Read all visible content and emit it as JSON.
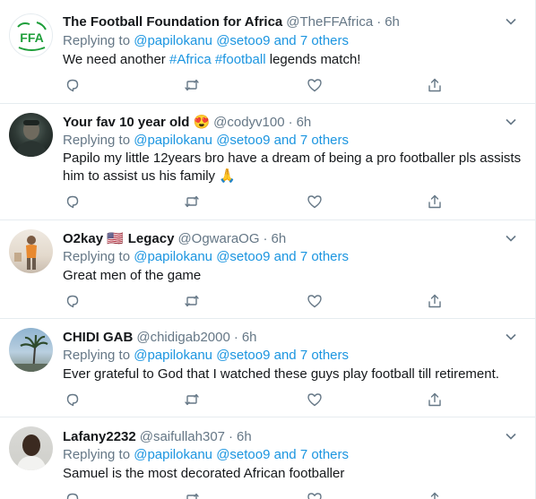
{
  "reply_prefix": "Replying to",
  "tweets": [
    {
      "name": "The Football Foundation for Africa",
      "handle": "@TheFFAfrica",
      "sep": "·",
      "time": "6h",
      "reply_to": [
        "@papilokanu",
        "@setoo9",
        "and 7 others"
      ],
      "text_parts": [
        "We need another ",
        "#Africa",
        " ",
        "#football",
        " legends match!"
      ],
      "avatar_logo_text": "FFA"
    },
    {
      "name": "Your fav 10 year old",
      "name_emoji": "😍",
      "handle": "@codyv100",
      "sep": "·",
      "time": "6h",
      "reply_to": [
        "@papilokanu",
        "@setoo9",
        "and 7 others"
      ],
      "text_line1": "Papilo my little 12years bro have a dream of being a pro footballer pls assists",
      "text_line2": "him to assist us his family",
      "text_emoji": "🙏"
    },
    {
      "name": "O2kay",
      "name_flag": "🇺🇸",
      "name_suffix": "Legacy",
      "handle": "@OgwaraOG",
      "sep": "·",
      "time": "6h",
      "reply_to": [
        "@papilokanu",
        "@setoo9",
        "and 7 others"
      ],
      "text": "Great men of the game"
    },
    {
      "name": "CHIDI GAB",
      "handle": "@chidigab2000",
      "sep": "·",
      "time": "6h",
      "reply_to": [
        "@papilokanu",
        "@setoo9",
        "and 7 others"
      ],
      "text": "Ever grateful to God that I watched these guys play football till retirement."
    },
    {
      "name": "Lafany2232",
      "handle": "@saifullah307",
      "sep": "·",
      "time": "6h",
      "reply_to": [
        "@papilokanu",
        "@setoo9",
        "and 7 others"
      ],
      "text": "Samuel is the most decorated African footballer"
    }
  ],
  "colors": {
    "link": "#1b95e0",
    "secondary_text": "#657786",
    "primary_text": "#14171a",
    "divider": "#e6ecf0",
    "ffa_green": "#1e9e3a"
  },
  "icons": [
    "reply-icon",
    "retweet-icon",
    "like-icon",
    "share-icon",
    "chevron-down-icon"
  ]
}
